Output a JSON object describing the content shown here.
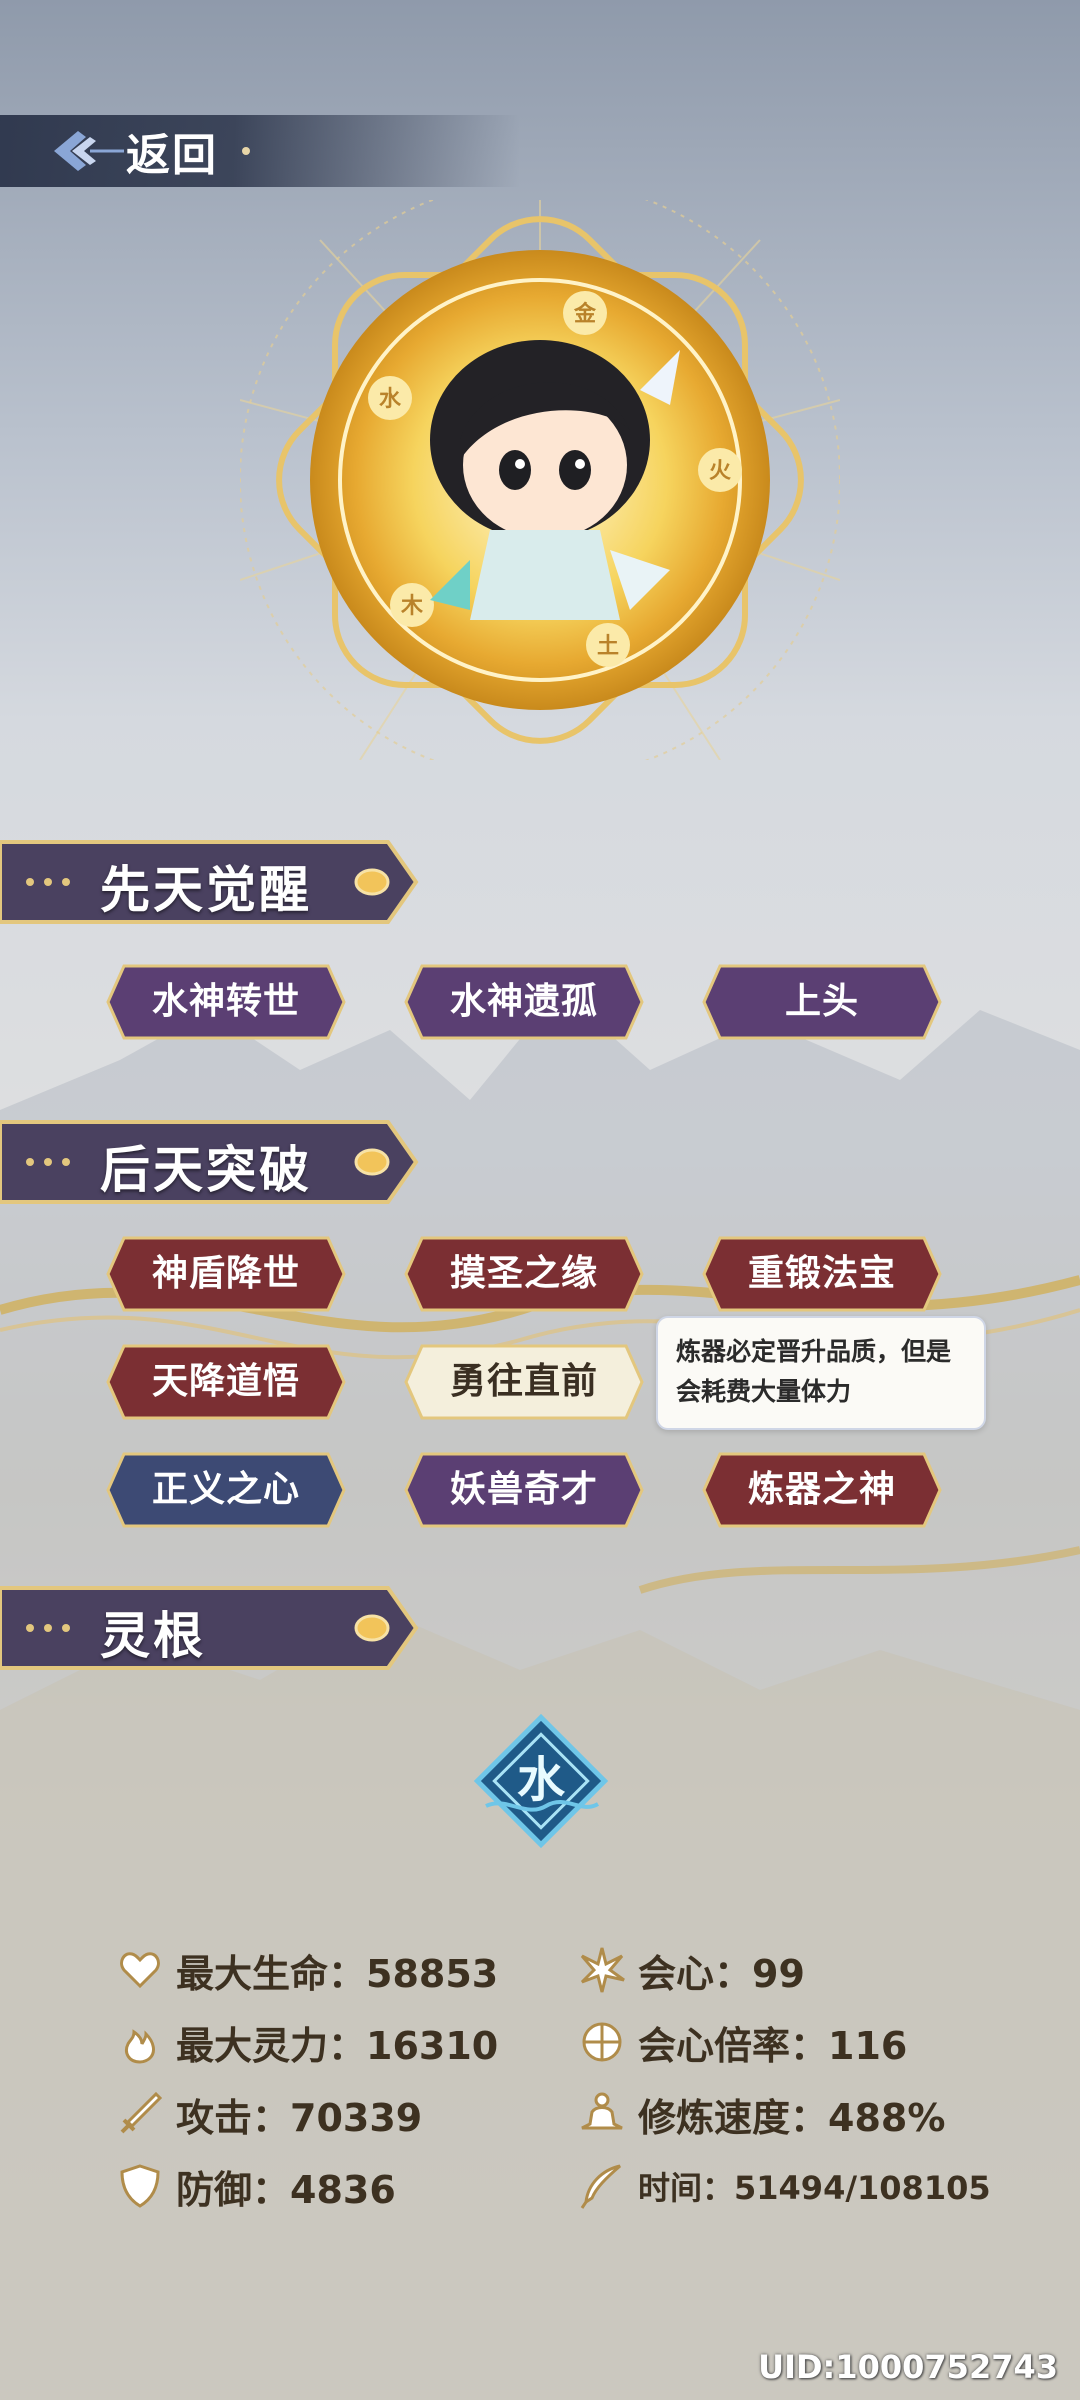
{
  "nav": {
    "back_label": "返回"
  },
  "portrait": {
    "element_glyphs": [
      "金",
      "水",
      "火",
      "木",
      "土"
    ]
  },
  "innate": {
    "title": "先天觉醒",
    "tags": [
      "水神转世",
      "水神遗孤",
      "上头"
    ]
  },
  "acquired": {
    "title": "后天突破",
    "tags": [
      "神盾降世",
      "摸圣之缘",
      "重锻法宝",
      "天降道悟",
      "勇往直前",
      "正义之心",
      "妖兽奇才",
      "炼器之神"
    ],
    "selected": "勇往直前",
    "tooltip": "炼器必定晋升品质，但是会耗费大量体力"
  },
  "spirit_root": {
    "title": "灵根",
    "element": "水"
  },
  "stats": {
    "max_hp": "最大生命：58853",
    "max_mana": "最大灵力：16310",
    "attack": "攻击：70339",
    "defense": "防御：4836",
    "crit": "会心：99",
    "crit_rate": "会心倍率：116",
    "cultivation_speed": "修炼速度：488%",
    "time": "时间：51494/108105"
  },
  "uid": "UID:1000752743",
  "colors": {
    "purple_tag": "#5b3f73",
    "red_tag": "#7b2f33",
    "blue_tag": "#3d4a74",
    "gold_border": "#e3c77e",
    "header_bg": "#4a4160"
  }
}
